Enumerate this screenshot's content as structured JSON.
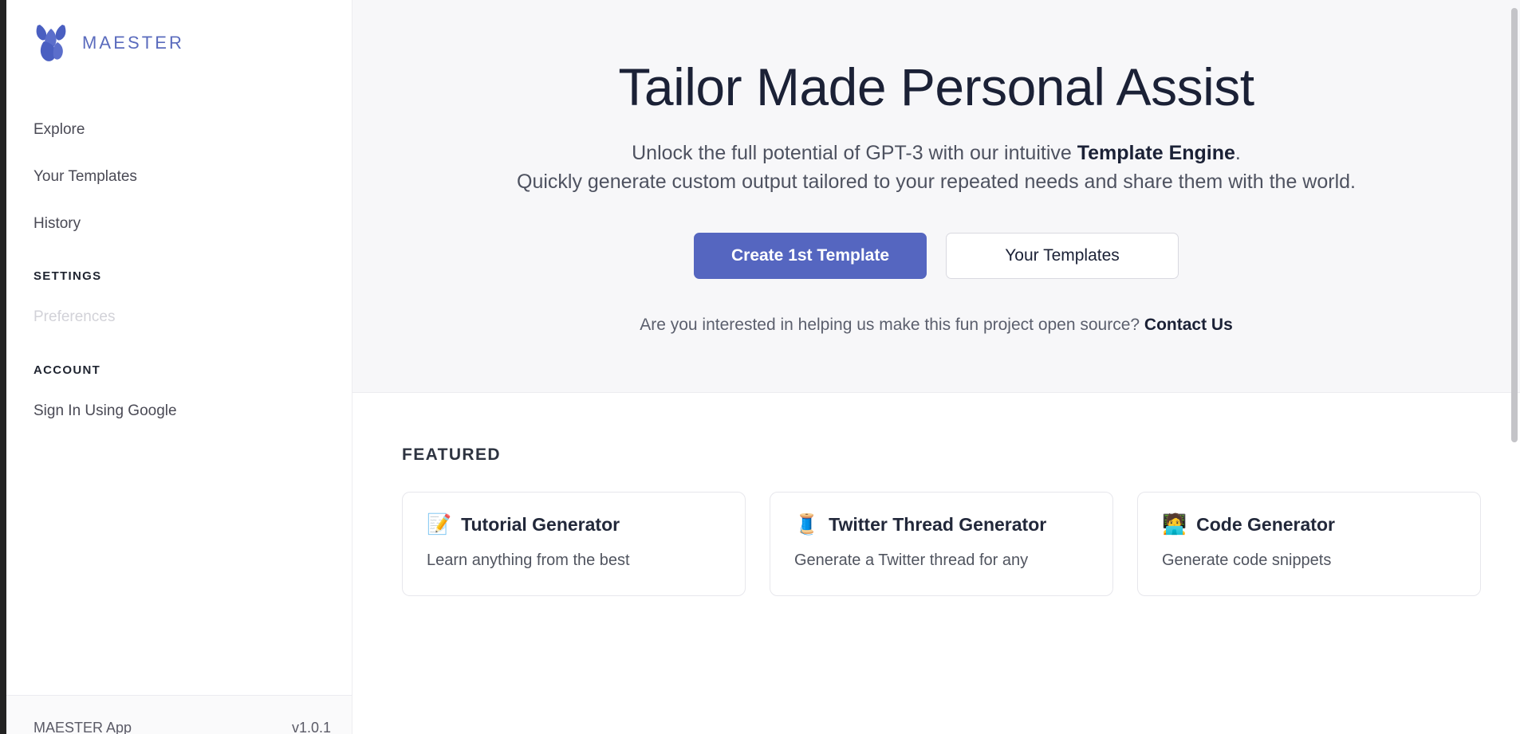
{
  "app": {
    "brand_name": "MAESTER",
    "logo_icon": "maester-flower-logo",
    "accent_color": "#5566c0",
    "brand_text_color": "#5a6bbd"
  },
  "sidebar": {
    "nav_items": [
      {
        "label": "Explore",
        "state": "default"
      },
      {
        "label": "Your Templates",
        "state": "default"
      },
      {
        "label": "History",
        "state": "default"
      }
    ],
    "groups": [
      {
        "title": "SETTINGS",
        "items": [
          {
            "label": "Preferences",
            "state": "disabled"
          }
        ]
      },
      {
        "title": "ACCOUNT",
        "items": [
          {
            "label": "Sign In Using Google",
            "state": "default"
          }
        ]
      }
    ],
    "footer": {
      "app_label": "MAESTER App",
      "version": "v1.0.1"
    }
  },
  "hero": {
    "title": "Tailor Made Personal Assist",
    "subtitle_line1_pre": "Unlock the full potential of GPT-3 with our intuitive ",
    "subtitle_line1_bold": "Template Engine",
    "subtitle_line1_post": ".",
    "subtitle_line2": "Quickly generate custom output tailored to your repeated needs and share them with the world.",
    "primary_button": "Create 1st Template",
    "secondary_button": "Your Templates",
    "note_text": "Are you interested in helping us make this fun project open source? ",
    "note_link": "Contact Us"
  },
  "featured": {
    "section_title": "FEATURED",
    "cards": [
      {
        "emoji": "📝",
        "icon_name": "page-with-pen-icon",
        "title": "Tutorial Generator",
        "desc": "Learn anything from the best"
      },
      {
        "emoji": "🧵",
        "icon_name": "thread-spool-icon",
        "title": "Twitter Thread Generator",
        "desc": "Generate a Twitter thread for any"
      },
      {
        "emoji": "🧑‍💻",
        "icon_name": "technologist-icon",
        "title": "Code Generator",
        "desc": "Generate code snippets"
      }
    ]
  }
}
